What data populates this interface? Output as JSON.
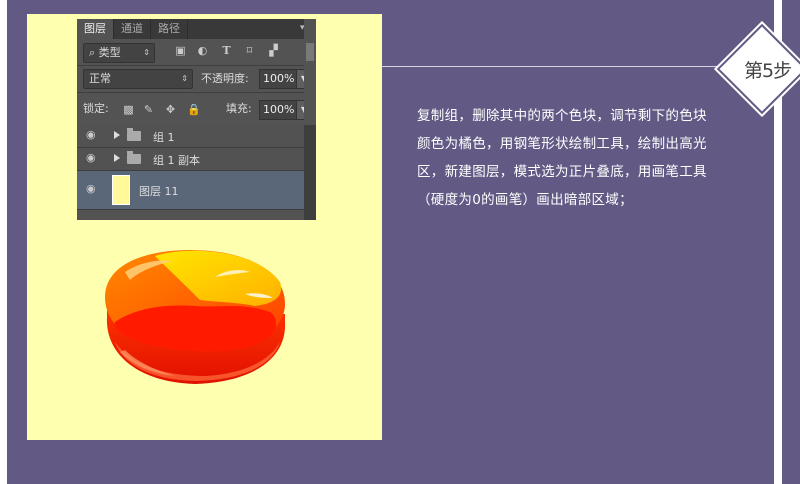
{
  "step_badge": "第5步",
  "description": "复制组，删除其中的两个色块，调节剩下的色块颜色为橘色，用钢笔形状绘制工具，绘制出高光区，新建图层，模式选为正片叠底，用画笔工具（硬度为0的画笔）画出暗部区域；",
  "ps_panel": {
    "tabs": [
      "图层",
      "通道",
      "路径"
    ],
    "filter_label": "类型",
    "blend_mode": "正常",
    "opacity_label": "不透明度:",
    "opacity_value": "100%",
    "lock_label": "锁定:",
    "fill_label": "填充:",
    "fill_value": "100%",
    "layers": [
      {
        "name": "组 1",
        "type": "group"
      },
      {
        "name": "组 1 副本",
        "type": "group"
      },
      {
        "name": "图层 11",
        "type": "layer",
        "selected": true
      }
    ]
  },
  "colors": {
    "background": "#625a85",
    "canvas": "#ffffb0",
    "selected_layer": "#5a6778"
  }
}
